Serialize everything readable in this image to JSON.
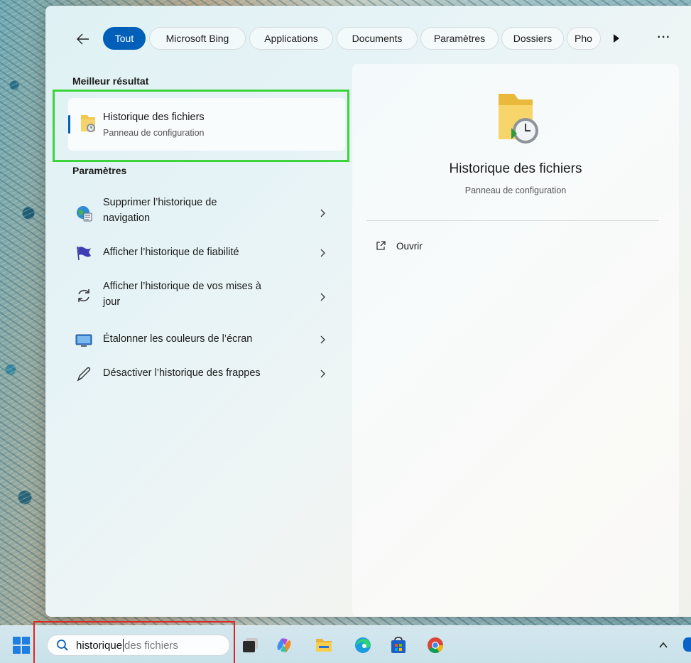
{
  "filters": {
    "chips": [
      {
        "label": "Tout",
        "active": true
      },
      {
        "label": "Microsoft Bing",
        "active": false
      },
      {
        "label": "Applications",
        "active": false
      },
      {
        "label": "Documents",
        "active": false
      },
      {
        "label": "Paramètres",
        "active": false
      },
      {
        "label": "Dossiers",
        "active": false
      },
      {
        "label": "Pho",
        "active": false
      }
    ],
    "more_label": "···"
  },
  "best_match": {
    "section_title": "Meilleur résultat",
    "title": "Historique des fichiers",
    "subtitle": "Panneau de configuration"
  },
  "settings": {
    "section_title": "Paramètres",
    "items": [
      {
        "line1": "Supprimer l’historique de",
        "line2": "navigation",
        "icon": "globe-settings-icon"
      },
      {
        "line1": "Afficher l’historique de fiabilité",
        "line2": "",
        "icon": "flag-icon"
      },
      {
        "line1": "Afficher l’historique de vos mises à",
        "line2": "jour",
        "icon": "sync-icon"
      },
      {
        "line1": "Étalonner les couleurs de l’écran",
        "line2": "",
        "icon": "monitor-icon"
      },
      {
        "line1": "Désactiver l’historique des frappes",
        "line2": "",
        "icon": "pen-icon"
      }
    ]
  },
  "preview": {
    "title": "Historique des fichiers",
    "subtitle": "Panneau de configuration",
    "open_label": "Ouvrir"
  },
  "taskbar": {
    "search_typed": "historique",
    "search_hint": "des fichiers",
    "apps": [
      "task-view-icon",
      "copilot-icon",
      "file-explorer-icon",
      "edge-icon",
      "store-icon",
      "chrome-icon"
    ]
  },
  "colors": {
    "accent": "#005fb8",
    "highlight_green": "#3bd43b",
    "highlight_red": "#e02424"
  }
}
